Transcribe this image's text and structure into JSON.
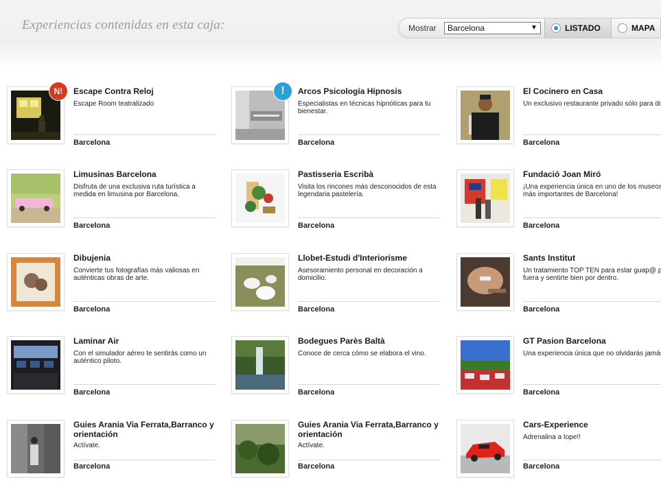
{
  "header": {
    "title": "Experiencias contenidas en esta caja:",
    "show_label": "Mostrar",
    "city_select": "Barcelona",
    "list_label": "LISTADO",
    "map_label": "MAPA",
    "active_view": "LISTADO",
    "accent_color": "#2a8fd8"
  },
  "experiences": [
    {
      "name": "Escape Contra Reloj",
      "desc": "Escape Room teatralizado",
      "city": "Barcelona",
      "badge": "N!",
      "thumb": "escape-room"
    },
    {
      "name": "Arcos Psicología Hipnosis",
      "desc": "Especialistas en técnicas hipnóticas para tu bienestar.",
      "city": "Barcelona",
      "badge": "!",
      "thumb": "office-sign"
    },
    {
      "name": "El Cocinero en Casa",
      "desc": "Un exclusivo restaurante privado sólo para dos.",
      "city": "Barcelona",
      "thumb": "chef"
    },
    {
      "name": "Limusinas Barcelona",
      "desc": "Disfruta de una exclusiva ruta turística a medida en limusina por Barcelona.",
      "city": "Barcelona",
      "thumb": "limousine"
    },
    {
      "name": "Pastisseria Escribà",
      "desc": "Visita los rincones más desconocidos de esta legendaria pastelería.",
      "city": "Barcelona",
      "thumb": "pastry"
    },
    {
      "name": "Fundació Joan Miró",
      "desc": "¡Una experiencia única en uno de los museos más importantes de Barcelona!",
      "city": "Barcelona",
      "thumb": "museum"
    },
    {
      "name": "Dibujenia",
      "desc": "Convierte tus fotografías más valiosas en auténticas obras de arte.",
      "city": "Barcelona",
      "thumb": "portrait"
    },
    {
      "name": "Llobet-Estudi d'Interiorisme",
      "desc": "Asesoramiento personal en decoración a domicilio.",
      "city": "Barcelona",
      "thumb": "decor"
    },
    {
      "name": "Sants Institut",
      "desc": "Un tratamiento TOP TEN para estar guap@ por fuera y sentirte bien por dentro.",
      "city": "Barcelona",
      "thumb": "facial"
    },
    {
      "name": "Laminar Air",
      "desc": "Con el simulador aéreo te sentirás como un auténtico piloto.",
      "city": "Barcelona",
      "thumb": "cockpit"
    },
    {
      "name": "Bodegues Parès Baltà",
      "desc": "Conoce de cerca cómo se elabora el vino.",
      "city": "Barcelona",
      "thumb": "waterfall"
    },
    {
      "name": "GT Pasion Barcelona",
      "desc": "Una experiencia única que no olvidarás jamás.",
      "city": "Barcelona",
      "thumb": "race-cars"
    },
    {
      "name": "Guies Arania Via Ferrata,Barranco y orientación",
      "desc": "Actívate.",
      "city": "Barcelona",
      "thumb": "canyon"
    },
    {
      "name": "Guies Arania Via Ferrata,Barranco y orientación",
      "desc": "Actívate.",
      "city": "Barcelona",
      "thumb": "forest"
    },
    {
      "name": "Cars-Experience",
      "desc": "Adrenalina a tope!!",
      "city": "Barcelona",
      "thumb": "ferrari"
    }
  ]
}
